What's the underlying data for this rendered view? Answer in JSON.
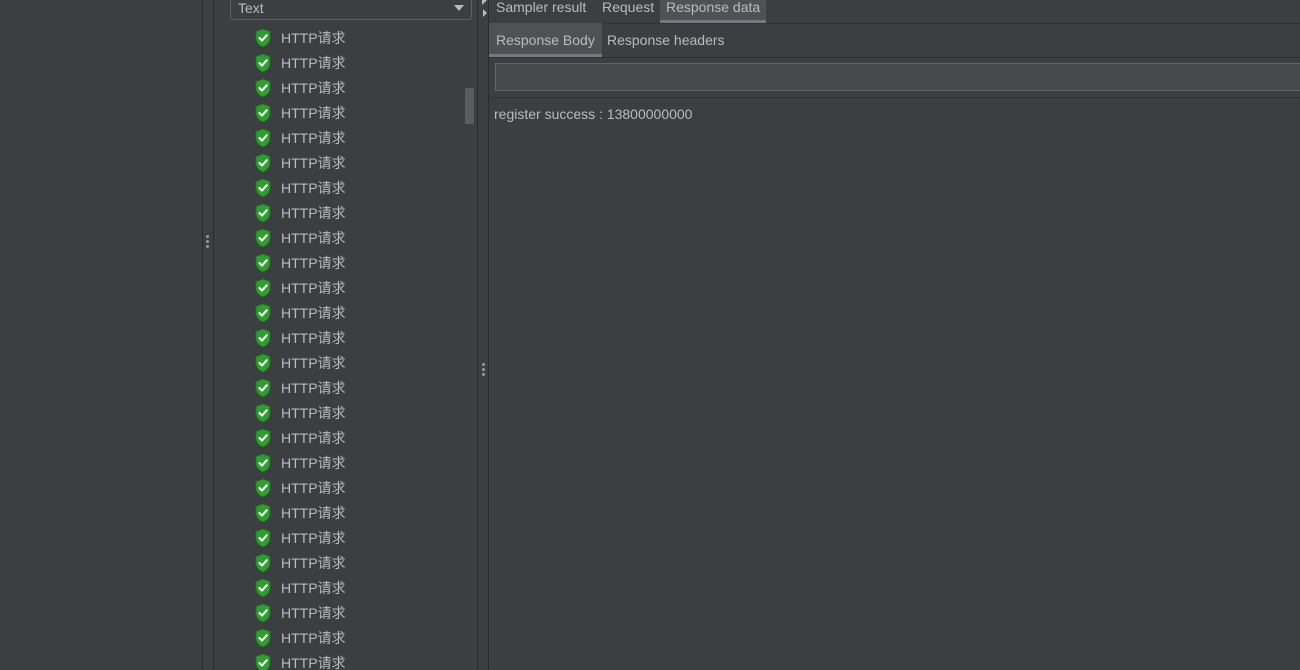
{
  "tree": {
    "renderer_combo": {
      "value": "Text"
    },
    "items": [
      {
        "label": "HTTP请求"
      },
      {
        "label": "HTTP请求"
      },
      {
        "label": "HTTP请求"
      },
      {
        "label": "HTTP请求"
      },
      {
        "label": "HTTP请求"
      },
      {
        "label": "HTTP请求"
      },
      {
        "label": "HTTP请求"
      },
      {
        "label": "HTTP请求"
      },
      {
        "label": "HTTP请求"
      },
      {
        "label": "HTTP请求"
      },
      {
        "label": "HTTP请求"
      },
      {
        "label": "HTTP请求"
      },
      {
        "label": "HTTP请求"
      },
      {
        "label": "HTTP请求"
      },
      {
        "label": "HTTP请求"
      },
      {
        "label": "HTTP请求"
      },
      {
        "label": "HTTP请求"
      },
      {
        "label": "HTTP请求"
      },
      {
        "label": "HTTP请求"
      },
      {
        "label": "HTTP请求"
      },
      {
        "label": "HTTP请求"
      },
      {
        "label": "HTTP请求"
      },
      {
        "label": "HTTP请求"
      },
      {
        "label": "HTTP请求"
      },
      {
        "label": "HTTP请求"
      },
      {
        "label": "HTTP请求"
      }
    ],
    "status_icon": "success-shield-check-icon"
  },
  "tabs": {
    "sampler_result": "Sampler result",
    "request": "Request",
    "response_data": "Response data"
  },
  "subtabs": {
    "response_body": "Response Body",
    "response_headers": "Response headers"
  },
  "search": {
    "value": ""
  },
  "response": {
    "text": "register success : 13800000000"
  },
  "colors": {
    "background": "#3c3f41",
    "text": "#bbbbbb",
    "success_icon": "#2e9e2e",
    "active_tab": "#4e5254"
  }
}
